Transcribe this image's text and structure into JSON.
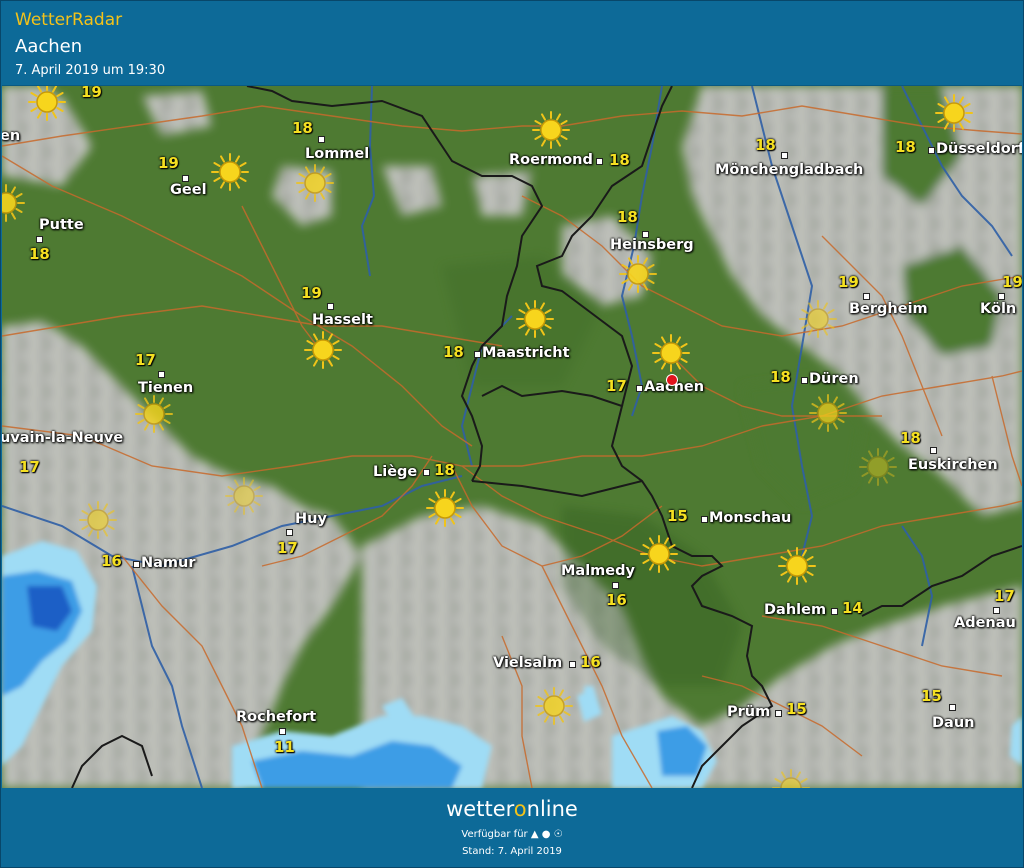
{
  "header": {
    "app_name": "WetterRadar",
    "location": "Aachen",
    "datetime": "7. April 2019 um 19:30"
  },
  "colors": {
    "accent": "#f3c21a",
    "header_bg": "#0d6a98",
    "forest": "#4e7a32",
    "cloud": "#b8b8b6",
    "rain_light": "#9fdcf5",
    "rain_mid": "#3d9de6",
    "rain_heavy": "#1f5fc6",
    "border": "#1a1a1a",
    "river": "#2f5fa6",
    "road": "#c86a2c"
  },
  "map": {
    "selected_location": "Aachen",
    "places": [
      {
        "name": "Lommel",
        "temp": "18"
      },
      {
        "name": "Roermond",
        "temp": "18"
      },
      {
        "name": "Mönchengladbach",
        "temp": "18"
      },
      {
        "name": "Düsseldorf",
        "temp": "18"
      },
      {
        "name": "Geel",
        "temp": "19"
      },
      {
        "name": "Putte",
        "temp": "18"
      },
      {
        "name": "Heinsberg",
        "temp": "18"
      },
      {
        "name": "Bergheim",
        "temp": "19"
      },
      {
        "name": "Köln",
        "temp": "19"
      },
      {
        "name": "Hasselt",
        "temp": "19"
      },
      {
        "name": "Maastricht",
        "temp": "18"
      },
      {
        "name": "Aachen",
        "temp": "17"
      },
      {
        "name": "Düren",
        "temp": "18"
      },
      {
        "name": "Tienen",
        "temp": "17"
      },
      {
        "name": "uvain-la-Neuve",
        "temp": "17"
      },
      {
        "name": "Euskirchen",
        "temp": "18"
      },
      {
        "name": "Liège",
        "temp": "18"
      },
      {
        "name": "Huy",
        "temp": "17"
      },
      {
        "name": "Monschau",
        "temp": "15"
      },
      {
        "name": "Namur",
        "temp": "16"
      },
      {
        "name": "Malmedy",
        "temp": "16"
      },
      {
        "name": "Dahlem",
        "temp": "14"
      },
      {
        "name": "Adenau",
        "temp": "17"
      },
      {
        "name": "Vielsalm",
        "temp": "16"
      },
      {
        "name": "Prüm",
        "temp": "15"
      },
      {
        "name": "Daun",
        "temp": "15"
      },
      {
        "name": "Rochefort",
        "temp": "11"
      }
    ],
    "edge_labels": {
      "left_top": "en",
      "top_temp": "19"
    }
  },
  "footer": {
    "brand_a": "wetter",
    "brand_o": "o",
    "brand_b": "nline",
    "available": "Verfügbar für",
    "platform_icons": [
      "android-icon",
      "apple-icon",
      "web-icon"
    ],
    "stand": "Stand: 7. April 2019"
  }
}
